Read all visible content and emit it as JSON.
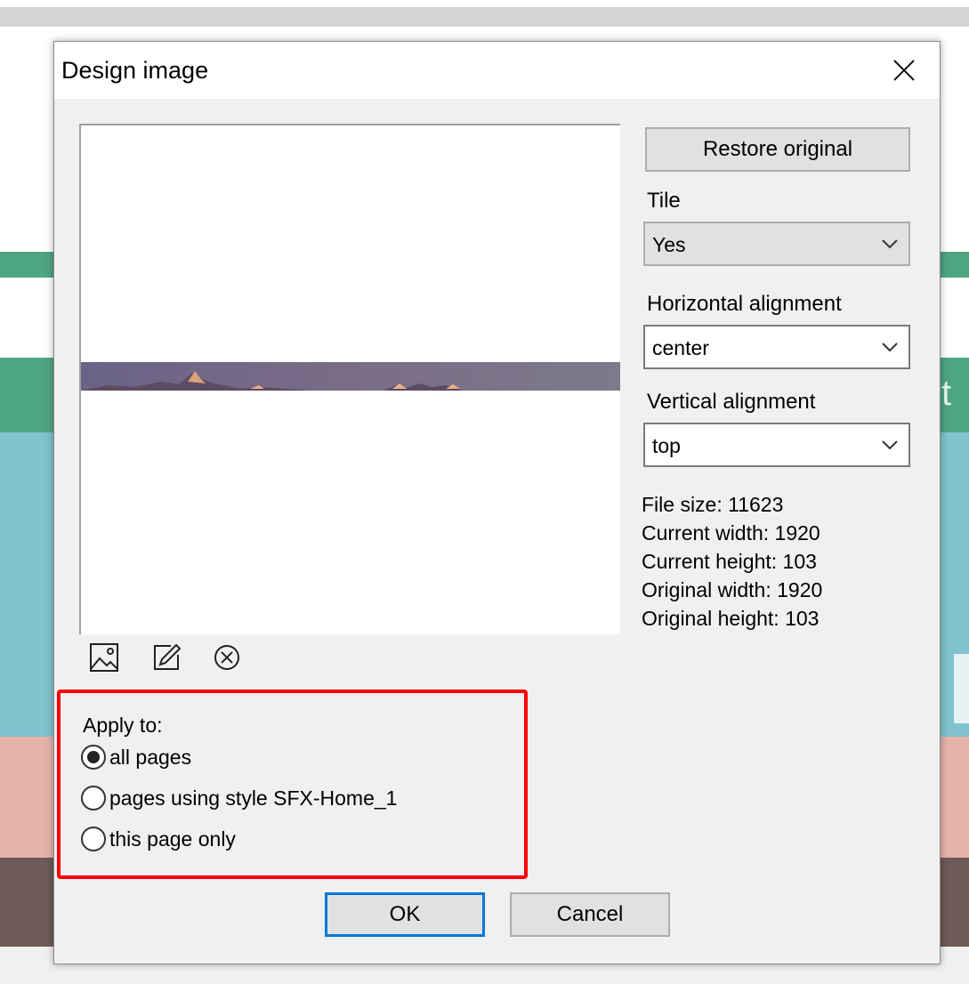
{
  "dialog": {
    "title": "Design image",
    "restore_label": "Restore original",
    "tile": {
      "label": "Tile",
      "value": "Yes"
    },
    "horizontal": {
      "label": "Horizontal alignment",
      "value": "center"
    },
    "vertical": {
      "label": "Vertical alignment",
      "value": "top"
    },
    "info": [
      "File size: 11623",
      "Current width: 1920",
      "Current height: 103",
      "Original width: 1920",
      "Original height: 103"
    ],
    "apply": {
      "label": "Apply to:",
      "options": [
        {
          "label": "all pages",
          "checked": true
        },
        {
          "label": "pages using style SFX-Home_1",
          "checked": false
        },
        {
          "label": "this page only",
          "checked": false
        }
      ]
    },
    "ok_label": "OK",
    "cancel_label": "Cancel"
  },
  "icons": {
    "close": "close-icon",
    "insert_image": "image-icon",
    "edit": "edit-icon",
    "remove": "remove-icon",
    "dropdown": "chevron-down-icon"
  },
  "background": {
    "partial_text": "t"
  },
  "colors": {
    "highlight": "#ff0000",
    "focus": "#0078d7",
    "dialog_bg": "#f0f0f0"
  }
}
